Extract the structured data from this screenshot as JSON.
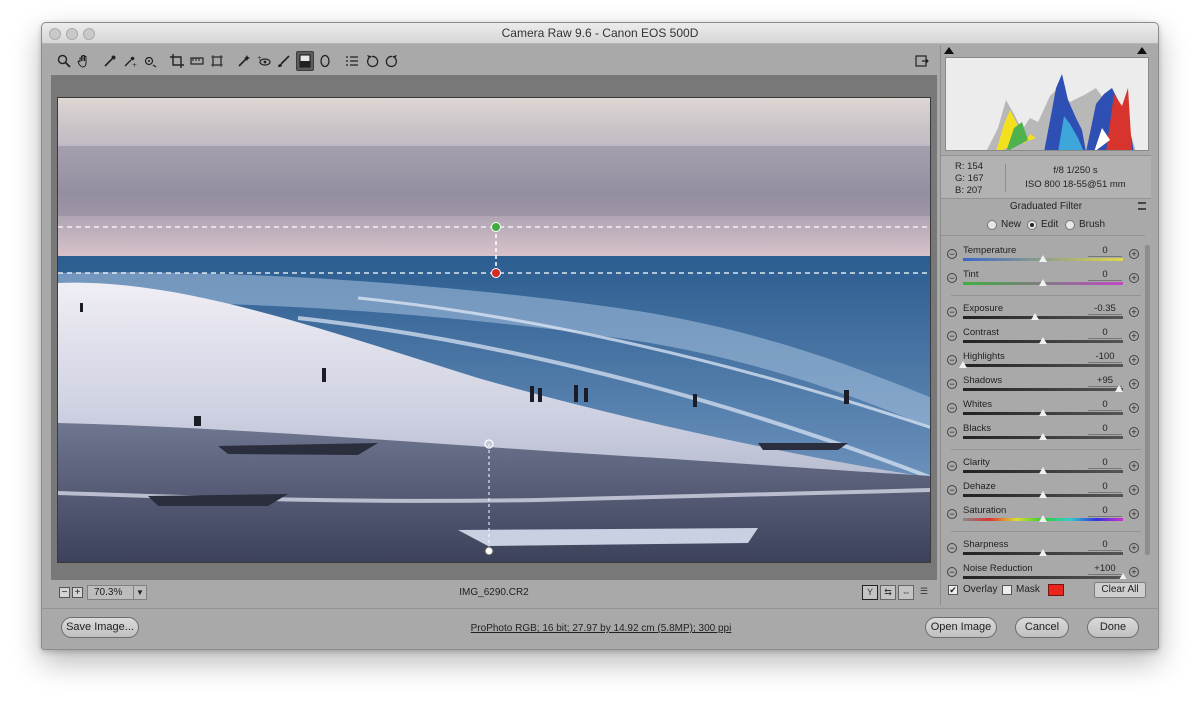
{
  "window": {
    "title": "Camera Raw 9.6  -  Canon EOS 500D"
  },
  "toolbar": {
    "tools": [
      {
        "name": "zoom-tool-icon"
      },
      {
        "name": "hand-tool-icon"
      },
      {
        "name": "white-balance-tool-icon"
      },
      {
        "name": "color-sampler-tool-icon"
      },
      {
        "name": "targeted-adjustment-tool-icon"
      },
      {
        "name": "crop-tool-icon"
      },
      {
        "name": "straighten-tool-icon"
      },
      {
        "name": "transform-tool-icon"
      },
      {
        "name": "spot-removal-tool-icon"
      },
      {
        "name": "red-eye-removal-tool-icon"
      },
      {
        "name": "adjustment-brush-icon"
      },
      {
        "name": "graduated-filter-icon",
        "active": true
      },
      {
        "name": "radial-filter-icon"
      },
      {
        "name": "preferences-icon"
      },
      {
        "name": "rotate-ccw-icon"
      },
      {
        "name": "rotate-cw-icon"
      }
    ],
    "fullscreen_icon": "fullscreen-toggle-icon"
  },
  "status": {
    "zoom": "70.3%",
    "filename": "IMG_6290.CR2",
    "zoom_out": "−",
    "zoom_in": "+",
    "view_y": "Y",
    "view_swap": "⇆",
    "view_copy": "⇔",
    "view_settings": "☰"
  },
  "readout": {
    "r": "R:  154",
    "g": "G:  167",
    "b": "B:  207",
    "exposure": "f/8     1/250 s",
    "lens": "ISO 800    18-55@51 mm"
  },
  "panel": {
    "title": "Graduated Filter",
    "modes": [
      {
        "label": "New",
        "selected": false
      },
      {
        "label": "Edit",
        "selected": true
      },
      {
        "label": "Brush",
        "selected": false
      }
    ],
    "sliders": [
      {
        "label": "Temperature",
        "value": "0",
        "pos": 0.5,
        "track": "temperature"
      },
      {
        "label": "Tint",
        "value": "0",
        "pos": 0.5,
        "track": "tint"
      },
      {
        "label": "Exposure",
        "value": "-0.35",
        "pos": 0.45,
        "track": "gray"
      },
      {
        "label": "Contrast",
        "value": "0",
        "pos": 0.5,
        "track": "gray"
      },
      {
        "label": "Highlights",
        "value": "-100",
        "pos": 0.0,
        "track": "gray"
      },
      {
        "label": "Shadows",
        "value": "+95",
        "pos": 0.975,
        "track": "gray"
      },
      {
        "label": "Whites",
        "value": "0",
        "pos": 0.5,
        "track": "gray"
      },
      {
        "label": "Blacks",
        "value": "0",
        "pos": 0.5,
        "track": "gray"
      },
      {
        "label": "Clarity",
        "value": "0",
        "pos": 0.5,
        "track": "gray"
      },
      {
        "label": "Dehaze",
        "value": "0",
        "pos": 0.5,
        "track": "gray"
      },
      {
        "label": "Saturation",
        "value": "0",
        "pos": 0.5,
        "track": "saturation"
      },
      {
        "label": "Sharpness",
        "value": "0",
        "pos": 0.5,
        "track": "gray"
      },
      {
        "label": "Noise Reduction",
        "value": "+100",
        "pos": 1.0,
        "track": "gray"
      }
    ],
    "overlay_label": "Overlay",
    "overlay_checked": true,
    "mask_label": "Mask",
    "mask_checked": false,
    "mask_color": "#e8261e",
    "clear_all": "Clear All"
  },
  "bottom": {
    "save": "Save Image...",
    "workflow": "ProPhoto RGB; 16 bit; 27.97 by 14.92 cm (5.8MP); 300 ppi",
    "open": "Open Image",
    "cancel": "Cancel",
    "done": "Done"
  },
  "colors": {
    "filter_start": "#3fae3f",
    "filter_end": "#d62a26"
  }
}
